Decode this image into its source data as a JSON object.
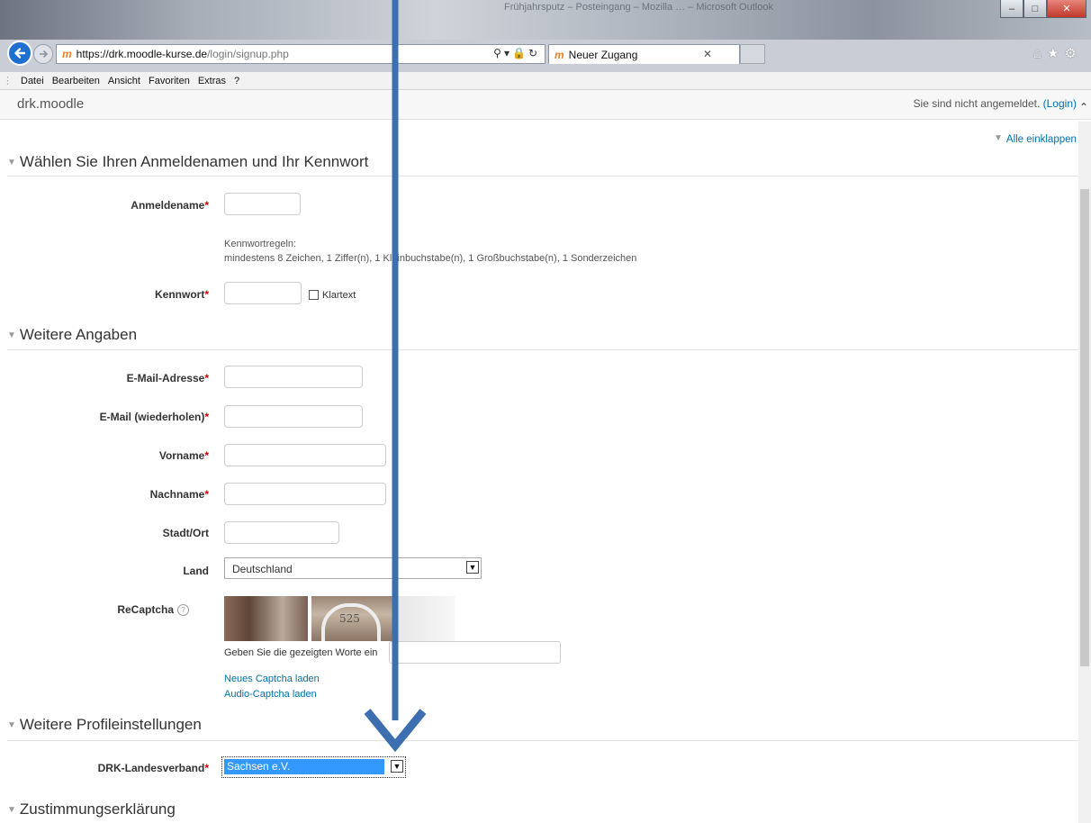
{
  "browser": {
    "window_title_blurred": "Frühjahrsputz – Posteingang – Mozilla … – Microsoft Outlook",
    "url_host": "https://drk.moodle-kurse.de",
    "url_path": "/login/signup.php",
    "tab_title": "Neuer Zugang",
    "favicon": "m"
  },
  "menubar": {
    "items": [
      "Datei",
      "Bearbeiten",
      "Ansicht",
      "Favoriten",
      "Extras",
      "?"
    ]
  },
  "site": {
    "name": "drk.moodle",
    "login_status": "Sie sind nicht angemeldet.",
    "login_link": "(Login)",
    "collapse_all": "Alle einklappen"
  },
  "sections": {
    "credentials": "Wählen Sie Ihren Anmeldenamen und Ihr Kennwort",
    "further": "Weitere Angaben",
    "profile": "Weitere Profileinstellungen",
    "consent": "Zustimmungserklärung"
  },
  "fields": {
    "username": "Anmeldename",
    "password_rules_title": "Kennwortregeln:",
    "password_rules": "mindestens 8 Zeichen, 1 Ziffer(n), 1 Kleinbuchstabe(n), 1 Großbuchstabe(n), 1 Sonderzeichen",
    "password": "Kennwort",
    "show_password": "Klartext",
    "email": "E-Mail-Adresse",
    "email_repeat": "E-Mail (wiederholen)",
    "firstname": "Vorname",
    "lastname": "Nachname",
    "city": "Stadt/Ort",
    "country": "Land",
    "country_value": "Deutschland",
    "recaptcha": "ReCaptcha",
    "captcha_number": "525",
    "captcha_prompt": "Geben Sie die gezeigten Worte ein",
    "captcha_new": "Neues Captcha laden",
    "captcha_audio": "Audio-Captcha laden",
    "drk_landesverband": "DRK-Landesverband",
    "drk_value": "Sachsen e.V."
  },
  "required_mark": "*",
  "colors": {
    "link": "#0070a8",
    "arrow": "#3d6fb0",
    "required": "#cc0000",
    "selection": "#3399ff"
  }
}
